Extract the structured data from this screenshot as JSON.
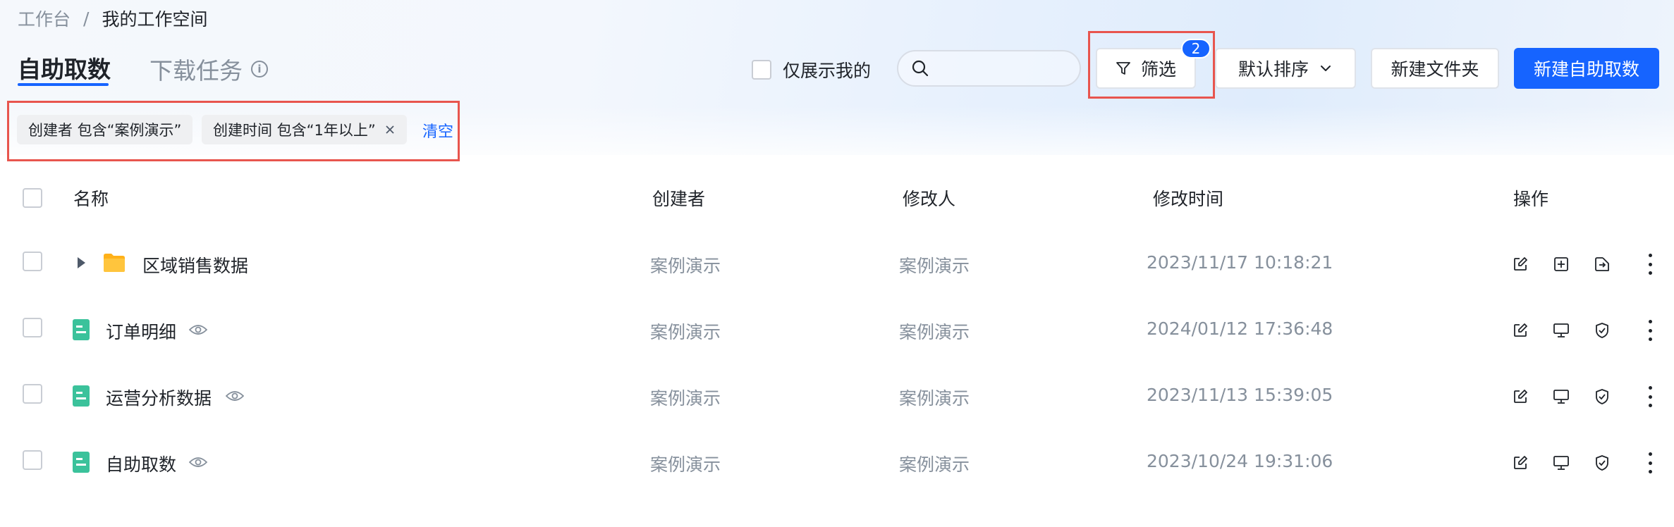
{
  "breadcrumb": {
    "root": "工作台",
    "separator": "/",
    "current": "我的工作空间"
  },
  "tabs": {
    "active": "自助取数",
    "inactive": "下载任务",
    "info_glyph": "i"
  },
  "toolbar": {
    "only_mine_label": "仅展示我的",
    "search_placeholder": "",
    "filter_label": "筛选",
    "filter_count": "2",
    "sort_label": "默认排序",
    "new_folder_label": "新建文件夹",
    "new_self_service_label": "新建自助取数"
  },
  "filters": {
    "chips": [
      "创建者 包含“案例演示”",
      "创建时间 包含“1年以上”"
    ],
    "clear_label": "清空"
  },
  "table": {
    "headers": {
      "name": "名称",
      "creator": "创建者",
      "modifier": "修改人",
      "modified_time": "修改时间",
      "actions": "操作"
    },
    "rows": [
      {
        "type": "folder",
        "name": "区域销售数据",
        "creator": "案例演示",
        "modifier": "案例演示",
        "modified_time": "2023/11/17 10:18:21"
      },
      {
        "type": "dataset",
        "name": "订单明细",
        "creator": "案例演示",
        "modifier": "案例演示",
        "modified_time": "2024/01/12 17:36:48"
      },
      {
        "type": "dataset",
        "name": "运营分析数据",
        "creator": "案例演示",
        "modifier": "案例演示",
        "modified_time": "2023/11/13 15:39:05"
      },
      {
        "type": "dataset",
        "name": "自助取数",
        "creator": "案例演示",
        "modifier": "案例演示",
        "modified_time": "2023/10/24 19:31:06"
      }
    ]
  },
  "colors": {
    "accent": "#1664ff",
    "highlight": "#e8554e",
    "folder": "#ffb119",
    "dataset": "#3bc29b",
    "muted_text": "#86909c"
  },
  "icons": {
    "folder_row_actions": [
      "edit-icon",
      "add-icon",
      "move-icon",
      "more-icon"
    ],
    "dataset_row_actions": [
      "edit-icon",
      "monitor-icon",
      "shield-icon",
      "more-icon"
    ]
  }
}
